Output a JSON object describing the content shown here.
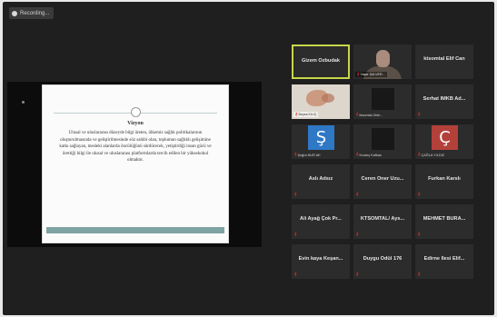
{
  "recording": {
    "label": "Recording..."
  },
  "slide": {
    "title": "Vizyon",
    "body": "Ulusal ve uluslararası düzeyde bilgi üreten, ülkemiz sağlık politikalarının oluşturulmasında ve geliştirilmesinde söz sahibi olan, toplumun sağlıklı gelişimine katkı sağlayan, mesleki alanlarda öncülüğünü sürdürecek, yetiştirdiği insan gücü ve ürettiği bilgi ile ulusal ve uluslararası platformlarda tercih edilen bir yüksekokul olmaktır."
  },
  "participants": [
    {
      "name": "Gizem Özbudak",
      "active": true
    },
    {
      "tag": "Yaşar ŞALVER..."
    },
    {
      "name": "ktsomtal Elif Can"
    },
    {
      "tag": "Beyza KILIÇ"
    },
    {
      "tag": "ktsomtal Zele..."
    },
    {
      "name": "Serhat İMKB Ad..."
    },
    {
      "initial": "Ş",
      "tag": "Şuğra NUR AK"
    },
    {
      "tag": "Kıvanç Kafkas"
    },
    {
      "initial": "Ç",
      "tag": "ÇAĞLA YILDIZ"
    },
    {
      "name": "Aslı Adsız"
    },
    {
      "name": "Ceren Öner Uzu..."
    },
    {
      "name": "Furkan Karslı"
    },
    {
      "name": "Ali Ayağ Çok Pr..."
    },
    {
      "name": "KTSOMTAL/ Ays..."
    },
    {
      "name": "MEHMET BURA..."
    },
    {
      "name": "Evin kaya Keşan..."
    },
    {
      "name": "Duygu Ödül 176"
    },
    {
      "name": "Edirne İlesi Elif..."
    }
  ],
  "colors": {
    "background": "#1f1f1f",
    "tile": "#2c2c2c",
    "active_border": "#c8d64a",
    "muted_mic": "#e03030",
    "avatar_blue": "#2e78c6",
    "avatar_red": "#b3413a",
    "slide_accent": "#7fa3a3"
  }
}
